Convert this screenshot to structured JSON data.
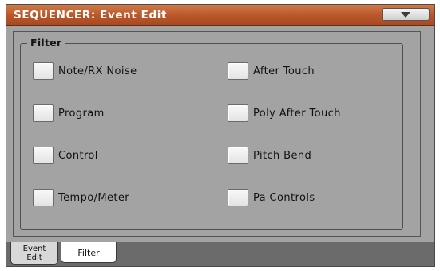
{
  "window": {
    "title": "SEQUENCER: Event Edit"
  },
  "filter_group": {
    "title": "Filter",
    "options": [
      {
        "label": "Note/RX Noise",
        "checked": false
      },
      {
        "label": "Program",
        "checked": false
      },
      {
        "label": "Control",
        "checked": false
      },
      {
        "label": "Tempo/Meter",
        "checked": false
      },
      {
        "label": "After Touch",
        "checked": false
      },
      {
        "label": "Poly After Touch",
        "checked": false
      },
      {
        "label": "Pitch Bend",
        "checked": false
      },
      {
        "label": "Pa Controls",
        "checked": false
      }
    ]
  },
  "tabs": [
    {
      "line1": "Event",
      "line2": "Edit",
      "active": false
    },
    {
      "label": "Filter",
      "active": true
    }
  ],
  "colors": {
    "titlebar": "#b9562a",
    "background": "#a3a3a3",
    "tabbar": "#6b6b6b"
  },
  "icons": {
    "menu": "triangle-down-icon"
  }
}
